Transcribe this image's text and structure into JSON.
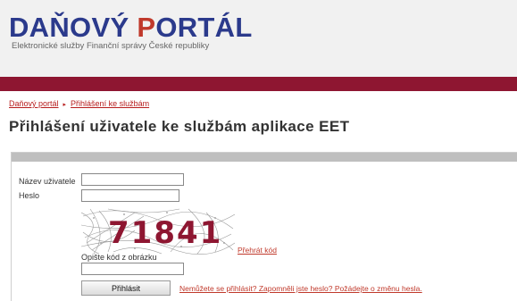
{
  "header": {
    "logo_part1": "DA",
    "logo_part2": "ŇOVÝ ",
    "logo_part3": "P",
    "logo_part4": "ORTÁL",
    "subtitle": "Elektronické služby Finanční správy České republiky"
  },
  "breadcrumb": {
    "item1": "Daňový portál",
    "separator": "▸",
    "item2": "Přihlášení ke službám"
  },
  "page": {
    "title": "Přihlášení uživatele ke službám aplikace EET"
  },
  "form": {
    "username_label": "Název uživatele",
    "username_value": "",
    "password_label": "Heslo",
    "password_value": "",
    "captcha_text": "71841",
    "play_code_link": "Přehrát kód",
    "captcha_input_label": "Opište kód z obrázku",
    "captcha_input_value": "",
    "login_button": "Přihlásit",
    "help_link": "Nemůžete se přihlásit? Zapomněli jste heslo? Požádejte o změnu hesla."
  },
  "colors": {
    "brand_blue": "#2b3a8c",
    "brand_red": "#c0392b",
    "topbar": "#8e1631",
    "captcha_text": "#8e1631"
  }
}
